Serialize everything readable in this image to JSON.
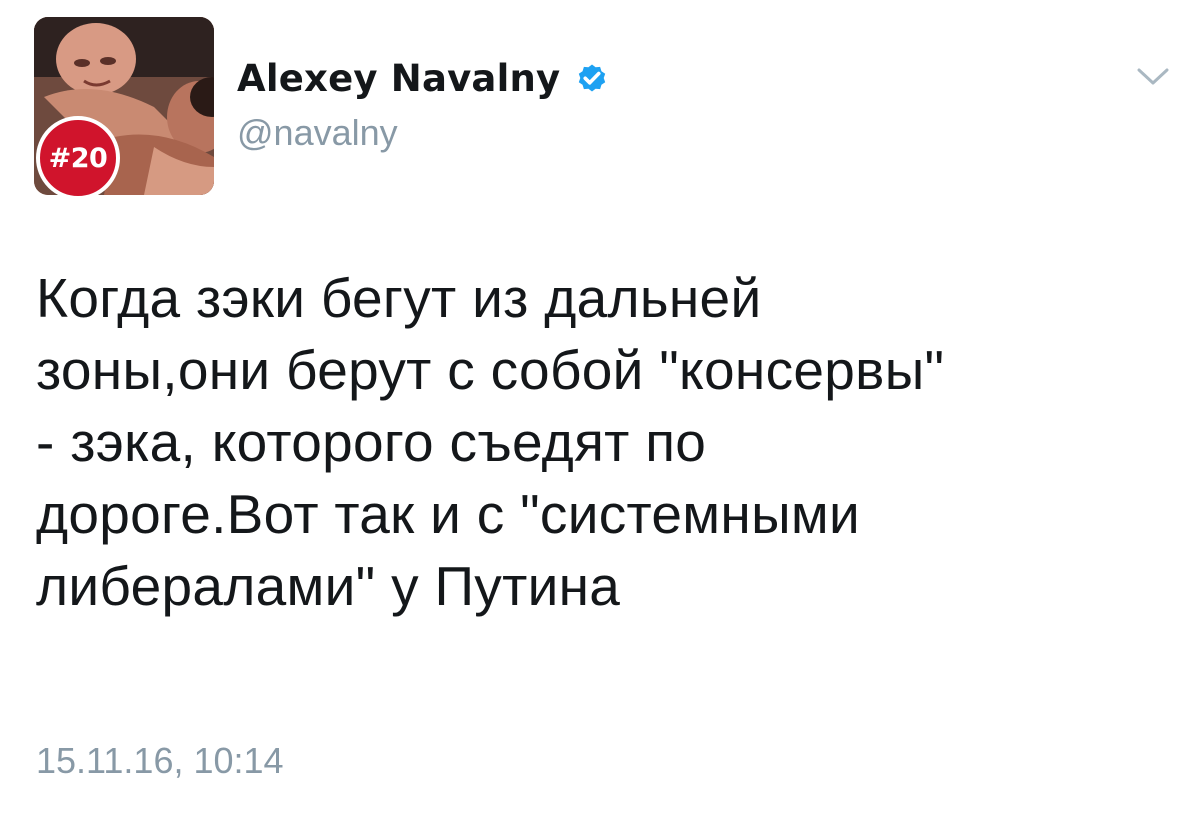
{
  "tweet": {
    "author": {
      "display_name": "Alexey Navalny",
      "handle": "@navalny",
      "verified": true,
      "avatar_badge": "#20"
    },
    "text": "Когда зэки бегут из дальней\nзоны,они берут с собой \"консервы\"\n- зэка, которого съедят по\nдороге.Вот так и с \"системными\nлибералами\" у Путина",
    "timestamp": "15.11.16, 10:14"
  },
  "icons": {
    "verified": "verified-badge-icon",
    "menu": "chevron-down-icon"
  },
  "colors": {
    "text": "#14171a",
    "secondary": "#8899a6",
    "verified_blue": "#1da1f2",
    "badge_red": "#d0142c"
  }
}
